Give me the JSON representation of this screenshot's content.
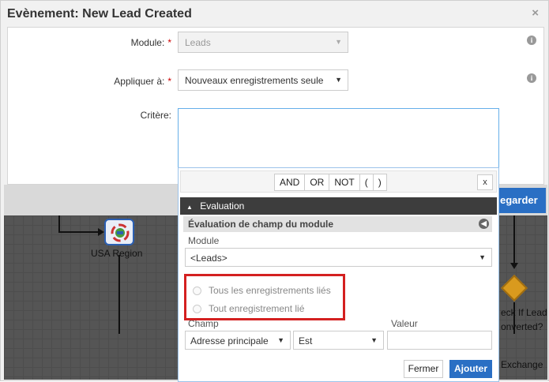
{
  "dialog": {
    "title": "Evènement: New Lead Created",
    "close_glyph": "×"
  },
  "form": {
    "module_label": "Module:",
    "module_value": "Leads",
    "apply_label": "Appliquer à:",
    "apply_value": "Nouveaux enregistrements seule",
    "criteria_label": "Critère:",
    "required_mark": "*",
    "info_glyph": "i"
  },
  "toolbar": {
    "save_label": "egarder"
  },
  "workflow": {
    "node_usa_label": "USA Region",
    "node_check_label_1": "eck If Lead",
    "node_check_label_2": "onverted?",
    "node_exchange_label": "Exchange"
  },
  "popup": {
    "operators": [
      "AND",
      "OR",
      "NOT",
      "(",
      ")"
    ],
    "close_glyph": "x",
    "section_title": "Evaluation",
    "section_toggle": "▲",
    "subsection_title": "Évaluation de champ du module",
    "module_field_label": "Module",
    "module_field_value": "<Leads>",
    "radio_all": "Tous les enregistrements liés",
    "radio_any": "Tout enregistrement lié",
    "champ_label": "Champ",
    "valeur_label": "Valeur",
    "champ_value": "Adresse principale",
    "operator_value": "Est",
    "close_button": "Fermer",
    "add_button": "Ajouter"
  },
  "colors": {
    "primary_button": "#2a6fc4",
    "highlight_box": "#d42020",
    "canvas": "#555555"
  }
}
